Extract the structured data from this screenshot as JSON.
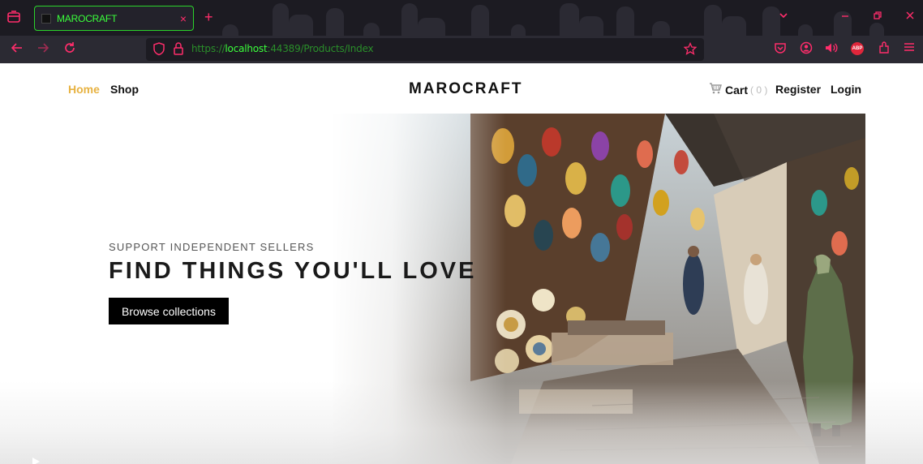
{
  "browser": {
    "tab_title": "MAROCRAFT",
    "tab_close": "×",
    "new_tab": "+",
    "url_scheme": "https://",
    "url_host": "localhost",
    "url_rest": ":44389/Products/Index",
    "accent_color": "#ff2d6b",
    "tab_text_color": "#3bff3b",
    "abp_label": "ABP"
  },
  "site": {
    "brand": "MAROCRAFT",
    "nav": {
      "home": "Home",
      "shop": "Shop",
      "cart": "Cart",
      "cart_count": "( 0 )",
      "register": "Register",
      "login": "Login"
    },
    "hero": {
      "eyebrow": "SUPPORT INDEPENDENT SELLERS",
      "headline": "FIND THINGS YOU'LL LOVE",
      "cta": "Browse collections"
    },
    "colors": {
      "home_active": "#e7b241",
      "cta_bg": "#000000",
      "text": "#111111"
    }
  }
}
